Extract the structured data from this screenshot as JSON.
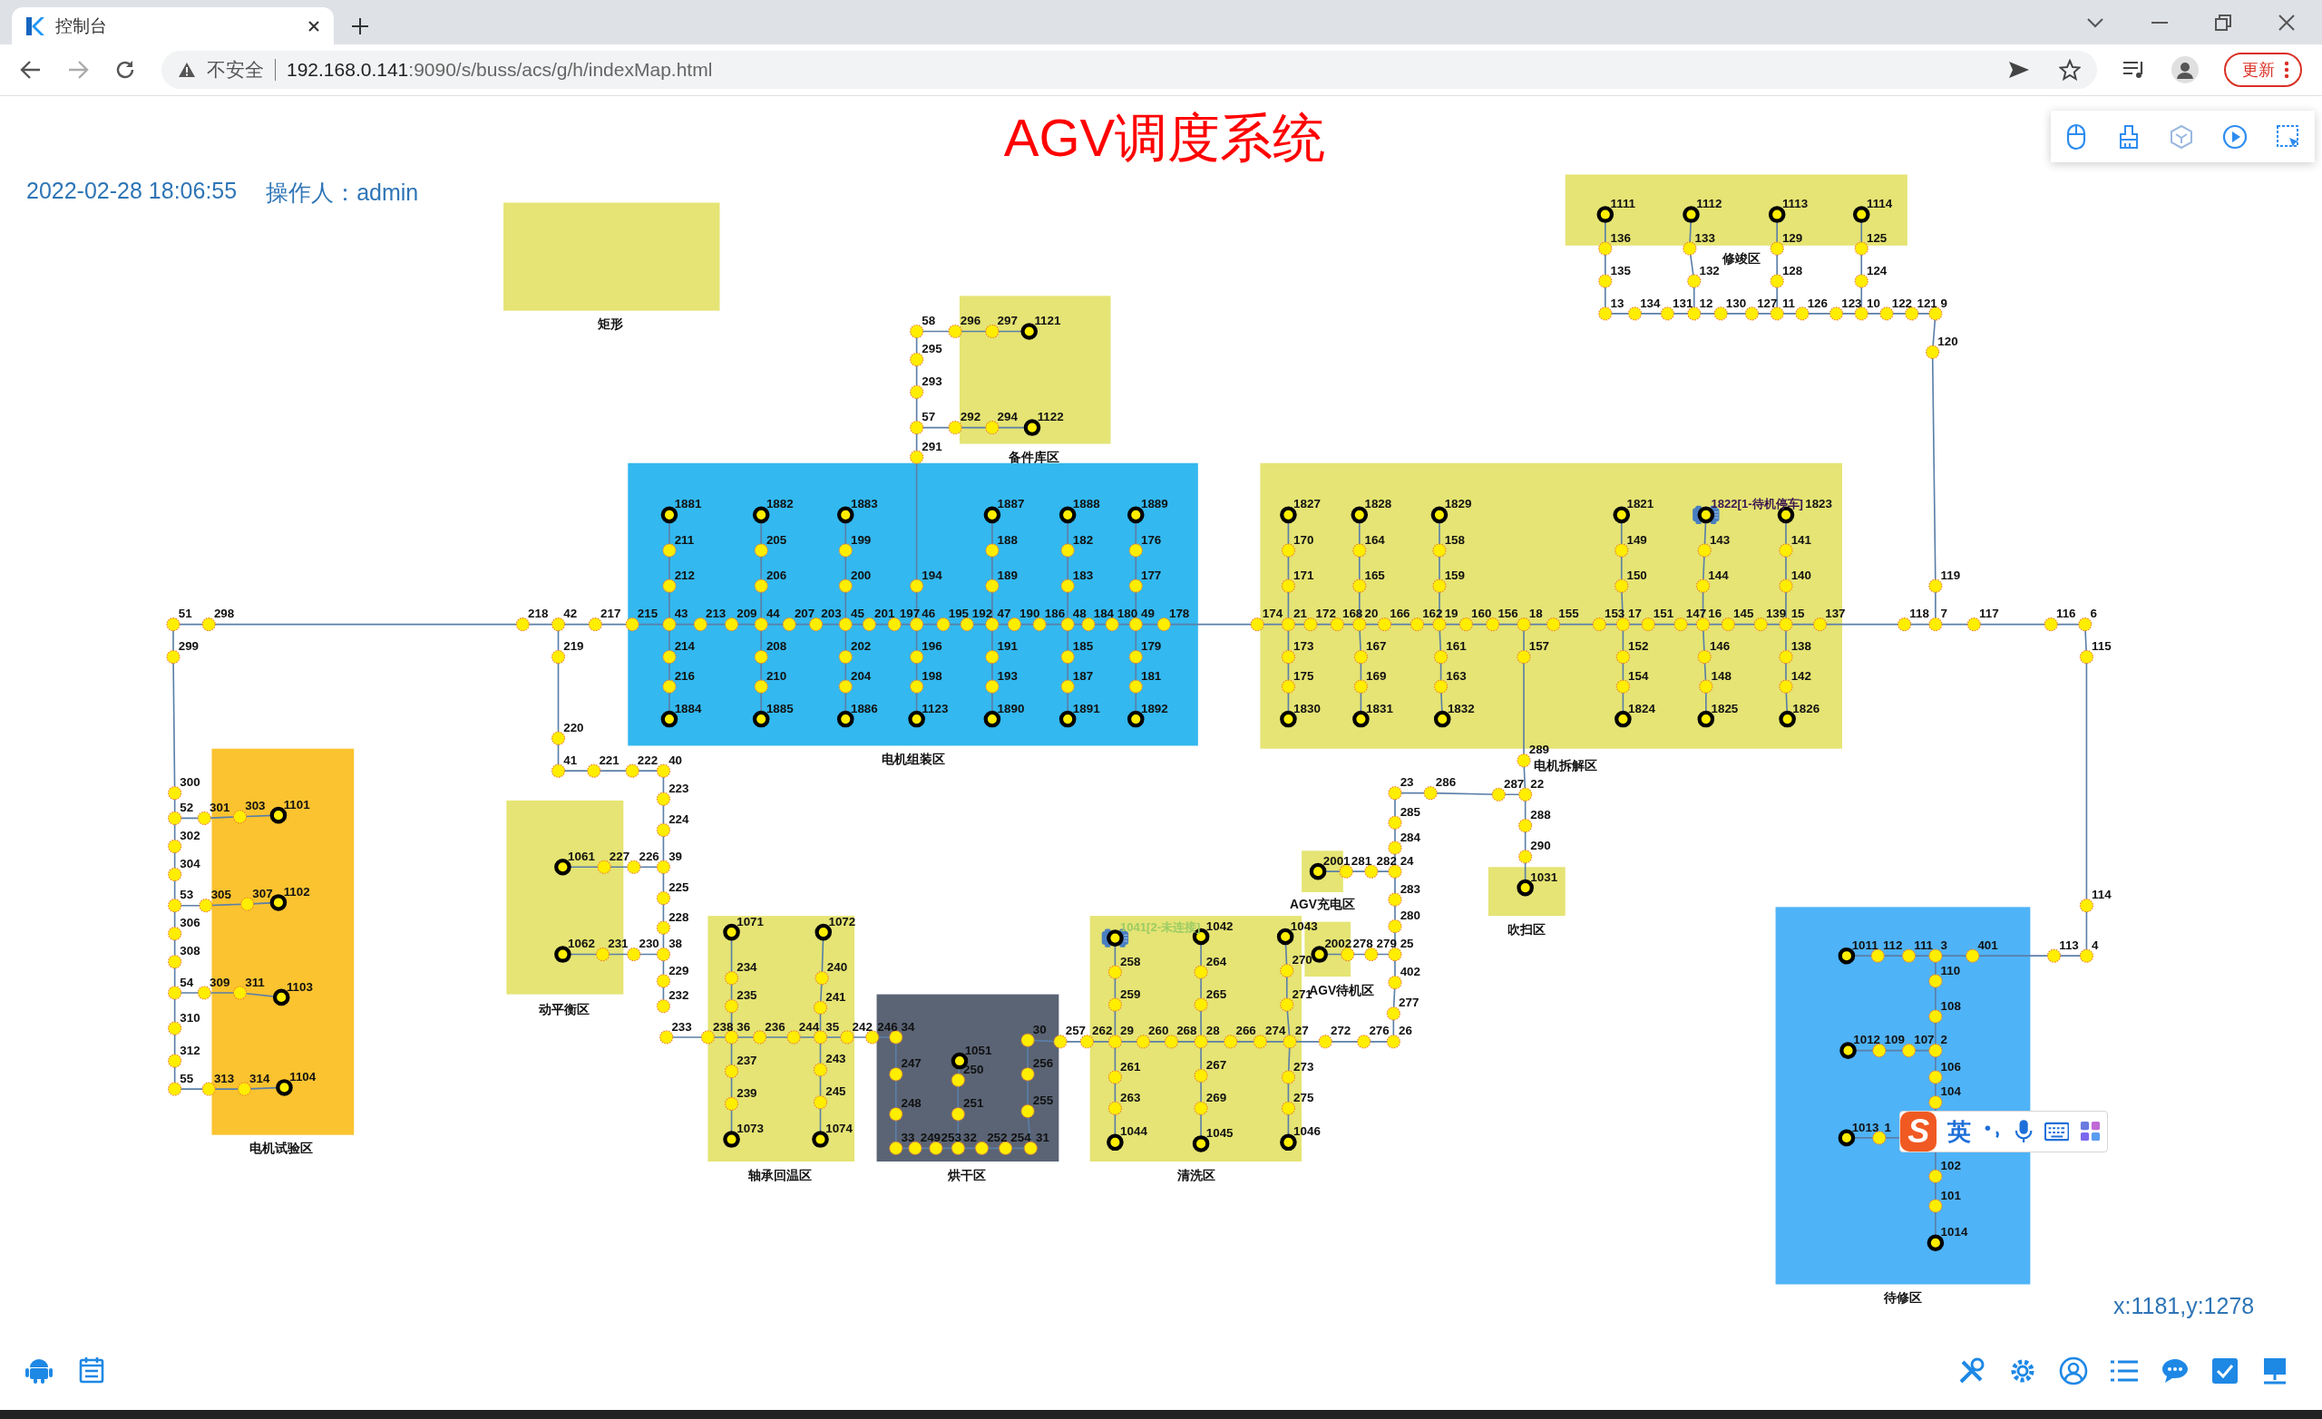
{
  "browser": {
    "tab": {
      "title": "控制台",
      "selected": true
    },
    "security": "不安全",
    "url_host": "192.168.0.141",
    "url_path": ":9090/s/buss/acs/g/h/indexMap.html",
    "update_button": "更新"
  },
  "header": {
    "title": "AGV调度系统",
    "datetime": "2022-02-28 18:06:55",
    "operator": "操作人：admin"
  },
  "zones": [
    {
      "label": "矩形",
      "color": "#e5e474"
    },
    {
      "label": "修竣区",
      "color": "#e5e474"
    },
    {
      "label": "备件库区",
      "color": "#e5e474"
    },
    {
      "label": "电机组装区",
      "color": "#33b8ef"
    },
    {
      "label": "电机拆解区",
      "color": "#e5e474"
    },
    {
      "label": "电机试验区",
      "color": "#fbc330"
    },
    {
      "label": "动平衡区",
      "color": "#e5e474"
    },
    {
      "label": "轴承回温区",
      "color": "#e5e474"
    },
    {
      "label": "烘干区",
      "color": "#5a6475"
    },
    {
      "label": "清洗区",
      "color": "#e5e474"
    },
    {
      "label": "AGV充电区",
      "color": "#e5e474"
    },
    {
      "label": "AGV待机区",
      "color": "#e5e474"
    },
    {
      "label": "吹扫区",
      "color": "#e5e474"
    },
    {
      "label": "待修区",
      "color": "#4fb3f7"
    }
  ],
  "nodes": [
    {
      "label": "1111",
      "kind": "station"
    },
    {
      "label": "1112",
      "kind": "station"
    },
    {
      "label": "1113",
      "kind": "station"
    },
    {
      "label": "1114",
      "kind": "station"
    },
    {
      "label": "136",
      "kind": "point"
    },
    {
      "label": "133",
      "kind": "point"
    },
    {
      "label": "129",
      "kind": "point"
    },
    {
      "label": "125",
      "kind": "point"
    },
    {
      "label": "135",
      "kind": "point"
    },
    {
      "label": "132",
      "kind": "point"
    },
    {
      "label": "128",
      "kind": "point"
    },
    {
      "label": "124",
      "kind": "point"
    },
    {
      "label": "13",
      "kind": "point"
    },
    {
      "label": "134",
      "kind": "point"
    },
    {
      "label": "131",
      "kind": "point"
    },
    {
      "label": "12",
      "kind": "point"
    },
    {
      "label": "130",
      "kind": "point"
    },
    {
      "label": "127",
      "kind": "point"
    },
    {
      "label": "11",
      "kind": "point"
    },
    {
      "label": "126",
      "kind": "point"
    },
    {
      "label": "123",
      "kind": "point"
    },
    {
      "label": "10",
      "kind": "point"
    },
    {
      "label": "122",
      "kind": "point"
    },
    {
      "label": "121",
      "kind": "point"
    },
    {
      "label": "9",
      "kind": "point"
    },
    {
      "label": "58",
      "kind": "point"
    },
    {
      "label": "296",
      "kind": "point"
    },
    {
      "label": "297",
      "kind": "point"
    },
    {
      "label": "1121",
      "kind": "station"
    },
    {
      "label": "295",
      "kind": "point"
    },
    {
      "label": "120",
      "kind": "point"
    },
    {
      "label": "293",
      "kind": "point"
    },
    {
      "label": "57",
      "kind": "point"
    },
    {
      "label": "292",
      "kind": "point"
    },
    {
      "label": "294",
      "kind": "point"
    },
    {
      "label": "1122",
      "kind": "station"
    },
    {
      "label": "291",
      "kind": "point"
    },
    {
      "label": "1881",
      "kind": "station"
    },
    {
      "label": "1882",
      "kind": "station"
    },
    {
      "label": "1883",
      "kind": "station"
    },
    {
      "label": "1887",
      "kind": "station"
    },
    {
      "label": "1888",
      "kind": "station"
    },
    {
      "label": "1889",
      "kind": "station"
    },
    {
      "label": "1827",
      "kind": "station"
    },
    {
      "label": "1828",
      "kind": "station"
    },
    {
      "label": "1829",
      "kind": "station"
    },
    {
      "label": "1821",
      "kind": "station"
    },
    {
      "label": "1822[1-待机停车]",
      "kind": "station",
      "vehicle": true,
      "connected": true
    },
    {
      "label": "1823",
      "kind": "station"
    },
    {
      "label": "211",
      "kind": "point"
    },
    {
      "label": "205",
      "kind": "point"
    },
    {
      "label": "199",
      "kind": "point"
    },
    {
      "label": "188",
      "kind": "point"
    },
    {
      "label": "182",
      "kind": "point"
    },
    {
      "label": "176",
      "kind": "point"
    },
    {
      "label": "170",
      "kind": "point"
    },
    {
      "label": "164",
      "kind": "point"
    },
    {
      "label": "158",
      "kind": "point"
    },
    {
      "label": "149",
      "kind": "point"
    },
    {
      "label": "143",
      "kind": "point"
    },
    {
      "label": "141",
      "kind": "point"
    },
    {
      "label": "212",
      "kind": "point"
    },
    {
      "label": "206",
      "kind": "point"
    },
    {
      "label": "200",
      "kind": "point"
    },
    {
      "label": "194",
      "kind": "point"
    },
    {
      "label": "189",
      "kind": "point"
    },
    {
      "label": "183",
      "kind": "point"
    },
    {
      "label": "177",
      "kind": "point"
    },
    {
      "label": "171",
      "kind": "point"
    },
    {
      "label": "165",
      "kind": "point"
    },
    {
      "label": "159",
      "kind": "point"
    },
    {
      "label": "150",
      "kind": "point"
    },
    {
      "label": "144",
      "kind": "point"
    },
    {
      "label": "140",
      "kind": "point"
    },
    {
      "label": "119",
      "kind": "point"
    },
    {
      "label": "51",
      "kind": "point"
    },
    {
      "label": "298",
      "kind": "point"
    },
    {
      "label": "218",
      "kind": "point"
    },
    {
      "label": "42",
      "kind": "point"
    },
    {
      "label": "217",
      "kind": "point"
    },
    {
      "label": "215",
      "kind": "point"
    },
    {
      "label": "43",
      "kind": "point"
    },
    {
      "label": "213",
      "kind": "point"
    },
    {
      "label": "209",
      "kind": "point"
    },
    {
      "label": "44",
      "kind": "point"
    },
    {
      "label": "207",
      "kind": "point"
    },
    {
      "label": "203",
      "kind": "point"
    },
    {
      "label": "45",
      "kind": "point"
    },
    {
      "label": "201",
      "kind": "point"
    },
    {
      "label": "197",
      "kind": "point"
    },
    {
      "label": "46",
      "kind": "point"
    },
    {
      "label": "195",
      "kind": "point"
    },
    {
      "label": "192",
      "kind": "point"
    },
    {
      "label": "47",
      "kind": "point"
    },
    {
      "label": "190",
      "kind": "point"
    },
    {
      "label": "186",
      "kind": "point"
    },
    {
      "label": "48",
      "kind": "point"
    },
    {
      "label": "184",
      "kind": "point"
    },
    {
      "label": "180",
      "kind": "point"
    },
    {
      "label": "49",
      "kind": "point"
    },
    {
      "label": "178",
      "kind": "point"
    },
    {
      "label": "174",
      "kind": "point"
    },
    {
      "label": "21",
      "kind": "point"
    },
    {
      "label": "172",
      "kind": "point"
    },
    {
      "label": "168",
      "kind": "point"
    },
    {
      "label": "20",
      "kind": "point"
    },
    {
      "label": "166",
      "kind": "point"
    },
    {
      "label": "162",
      "kind": "point"
    },
    {
      "label": "19",
      "kind": "point"
    },
    {
      "label": "160",
      "kind": "point"
    },
    {
      "label": "156",
      "kind": "point"
    },
    {
      "label": "18",
      "kind": "point"
    },
    {
      "label": "155",
      "kind": "point"
    },
    {
      "label": "153",
      "kind": "point"
    },
    {
      "label": "17",
      "kind": "point"
    },
    {
      "label": "151",
      "kind": "point"
    },
    {
      "label": "147",
      "kind": "point"
    },
    {
      "label": "16",
      "kind": "point"
    },
    {
      "label": "145",
      "kind": "point"
    },
    {
      "label": "139",
      "kind": "point"
    },
    {
      "label": "15",
      "kind": "point"
    },
    {
      "label": "137",
      "kind": "point"
    },
    {
      "label": "118",
      "kind": "point"
    },
    {
      "label": "7",
      "kind": "point"
    },
    {
      "label": "117",
      "kind": "point"
    },
    {
      "label": "116",
      "kind": "point"
    },
    {
      "label": "6",
      "kind": "point"
    },
    {
      "label": "299",
      "kind": "point"
    },
    {
      "label": "219",
      "kind": "point"
    },
    {
      "label": "214",
      "kind": "point"
    },
    {
      "label": "208",
      "kind": "point"
    },
    {
      "label": "202",
      "kind": "point"
    },
    {
      "label": "196",
      "kind": "point"
    },
    {
      "label": "191",
      "kind": "point"
    },
    {
      "label": "185",
      "kind": "point"
    },
    {
      "label": "179",
      "kind": "point"
    },
    {
      "label": "173",
      "kind": "point"
    },
    {
      "label": "167",
      "kind": "point"
    },
    {
      "label": "161",
      "kind": "point"
    },
    {
      "label": "157",
      "kind": "point"
    },
    {
      "label": "152",
      "kind": "point"
    },
    {
      "label": "146",
      "kind": "point"
    },
    {
      "label": "138",
      "kind": "point"
    },
    {
      "label": "115",
      "kind": "point"
    },
    {
      "label": "216",
      "kind": "point"
    },
    {
      "label": "210",
      "kind": "point"
    },
    {
      "label": "204",
      "kind": "point"
    },
    {
      "label": "198",
      "kind": "point"
    },
    {
      "label": "193",
      "kind": "point"
    },
    {
      "label": "187",
      "kind": "point"
    },
    {
      "label": "181",
      "kind": "point"
    },
    {
      "label": "175",
      "kind": "point"
    },
    {
      "label": "169",
      "kind": "point"
    },
    {
      "label": "163",
      "kind": "point"
    },
    {
      "label": "154",
      "kind": "point"
    },
    {
      "label": "148",
      "kind": "point"
    },
    {
      "label": "142",
      "kind": "point"
    },
    {
      "label": "1884",
      "kind": "station"
    },
    {
      "label": "1885",
      "kind": "station"
    },
    {
      "label": "1886",
      "kind": "station"
    },
    {
      "label": "1123",
      "kind": "station"
    },
    {
      "label": "1890",
      "kind": "station"
    },
    {
      "label": "1891",
      "kind": "station"
    },
    {
      "label": "1892",
      "kind": "station"
    },
    {
      "label": "1830",
      "kind": "station"
    },
    {
      "label": "1831",
      "kind": "station"
    },
    {
      "label": "1832",
      "kind": "station"
    },
    {
      "label": "1824",
      "kind": "station"
    },
    {
      "label": "1825",
      "kind": "station"
    },
    {
      "label": "1826",
      "kind": "station"
    },
    {
      "label": "220",
      "kind": "point"
    },
    {
      "label": "41",
      "kind": "point"
    },
    {
      "label": "221",
      "kind": "point"
    },
    {
      "label": "222",
      "kind": "point"
    },
    {
      "label": "40",
      "kind": "point"
    },
    {
      "label": "289",
      "kind": "point"
    },
    {
      "label": "300",
      "kind": "point"
    },
    {
      "label": "223",
      "kind": "point"
    },
    {
      "label": "23",
      "kind": "point"
    },
    {
      "label": "286",
      "kind": "point"
    },
    {
      "label": "287",
      "kind": "point"
    },
    {
      "label": "22",
      "kind": "point"
    },
    {
      "label": "52",
      "kind": "point"
    },
    {
      "label": "301",
      "kind": "point"
    },
    {
      "label": "303",
      "kind": "point"
    },
    {
      "label": "1101",
      "kind": "station"
    },
    {
      "label": "224",
      "kind": "point"
    },
    {
      "label": "285",
      "kind": "point"
    },
    {
      "label": "288",
      "kind": "point"
    },
    {
      "label": "302",
      "kind": "point"
    },
    {
      "label": "284",
      "kind": "point"
    },
    {
      "label": "290",
      "kind": "point"
    },
    {
      "label": "304",
      "kind": "point"
    },
    {
      "label": "1061",
      "kind": "station"
    },
    {
      "label": "227",
      "kind": "point"
    },
    {
      "label": "226",
      "kind": "point"
    },
    {
      "label": "39",
      "kind": "point"
    },
    {
      "label": "2001",
      "kind": "station"
    },
    {
      "label": "281",
      "kind": "point"
    },
    {
      "label": "282",
      "kind": "point"
    },
    {
      "label": "24",
      "kind": "point"
    },
    {
      "label": "1031",
      "kind": "station"
    },
    {
      "label": "53",
      "kind": "point"
    },
    {
      "label": "305",
      "kind": "point"
    },
    {
      "label": "307",
      "kind": "point"
    },
    {
      "label": "1102",
      "kind": "station"
    },
    {
      "label": "225",
      "kind": "point"
    },
    {
      "label": "283",
      "kind": "point"
    },
    {
      "label": "114",
      "kind": "point"
    },
    {
      "label": "306",
      "kind": "point"
    },
    {
      "label": "228",
      "kind": "point"
    },
    {
      "label": "1071",
      "kind": "station"
    },
    {
      "label": "1072",
      "kind": "station"
    },
    {
      "label": "1041[2-未连接]",
      "kind": "station",
      "vehicle": true,
      "connected": false
    },
    {
      "label": "1042",
      "kind": "station"
    },
    {
      "label": "1043",
      "kind": "station"
    },
    {
      "label": "280",
      "kind": "point"
    },
    {
      "label": "308",
      "kind": "point"
    },
    {
      "label": "1062",
      "kind": "station"
    },
    {
      "label": "231",
      "kind": "point"
    },
    {
      "label": "230",
      "kind": "point"
    },
    {
      "label": "38",
      "kind": "point"
    },
    {
      "label": "2002",
      "kind": "station"
    },
    {
      "label": "278",
      "kind": "point"
    },
    {
      "label": "279",
      "kind": "point"
    },
    {
      "label": "25",
      "kind": "point"
    },
    {
      "label": "1011",
      "kind": "station"
    },
    {
      "label": "112",
      "kind": "point"
    },
    {
      "label": "111",
      "kind": "point"
    },
    {
      "label": "3",
      "kind": "point"
    },
    {
      "label": "401",
      "kind": "point"
    },
    {
      "label": "113",
      "kind": "point"
    },
    {
      "label": "4",
      "kind": "point"
    },
    {
      "label": "229",
      "kind": "point"
    },
    {
      "label": "234",
      "kind": "point"
    },
    {
      "label": "240",
      "kind": "point"
    },
    {
      "label": "258",
      "kind": "point"
    },
    {
      "label": "264",
      "kind": "point"
    },
    {
      "label": "270",
      "kind": "point"
    },
    {
      "label": "402",
      "kind": "point"
    },
    {
      "label": "110",
      "kind": "point"
    },
    {
      "label": "54",
      "kind": "point"
    },
    {
      "label": "309",
      "kind": "point"
    },
    {
      "label": "311",
      "kind": "point"
    },
    {
      "label": "1103",
      "kind": "station"
    },
    {
      "label": "232",
      "kind": "point"
    },
    {
      "label": "235",
      "kind": "point"
    },
    {
      "label": "241",
      "kind": "point"
    },
    {
      "label": "259",
      "kind": "point"
    },
    {
      "label": "265",
      "kind": "point"
    },
    {
      "label": "271",
      "kind": "point"
    },
    {
      "label": "277",
      "kind": "point"
    },
    {
      "label": "108",
      "kind": "point"
    },
    {
      "label": "310",
      "kind": "point"
    },
    {
      "label": "233",
      "kind": "point"
    },
    {
      "label": "238",
      "kind": "point"
    },
    {
      "label": "36",
      "kind": "point"
    },
    {
      "label": "236",
      "kind": "point"
    },
    {
      "label": "244",
      "kind": "point"
    },
    {
      "label": "35",
      "kind": "point"
    },
    {
      "label": "242",
      "kind": "point"
    },
    {
      "label": "246",
      "kind": "point"
    },
    {
      "label": "34",
      "kind": "point"
    },
    {
      "label": "30",
      "kind": "point"
    },
    {
      "label": "257",
      "kind": "point"
    },
    {
      "label": "262",
      "kind": "point"
    },
    {
      "label": "29",
      "kind": "point"
    },
    {
      "label": "260",
      "kind": "point"
    },
    {
      "label": "268",
      "kind": "point"
    },
    {
      "label": "28",
      "kind": "point"
    },
    {
      "label": "266",
      "kind": "point"
    },
    {
      "label": "274",
      "kind": "point"
    },
    {
      "label": "27",
      "kind": "point"
    },
    {
      "label": "272",
      "kind": "point"
    },
    {
      "label": "276",
      "kind": "point"
    },
    {
      "label": "26",
      "kind": "point"
    },
    {
      "label": "1012",
      "kind": "station"
    },
    {
      "label": "109",
      "kind": "point"
    },
    {
      "label": "107",
      "kind": "point"
    },
    {
      "label": "2",
      "kind": "point"
    },
    {
      "label": "312",
      "kind": "point"
    },
    {
      "label": "237",
      "kind": "point"
    },
    {
      "label": "243",
      "kind": "point"
    },
    {
      "label": "247",
      "kind": "point"
    },
    {
      "label": "1051",
      "kind": "station"
    },
    {
      "label": "250",
      "kind": "point"
    },
    {
      "label": "256",
      "kind": "point"
    },
    {
      "label": "261",
      "kind": "point"
    },
    {
      "label": "267",
      "kind": "point"
    },
    {
      "label": "273",
      "kind": "point"
    },
    {
      "label": "106",
      "kind": "point"
    },
    {
      "label": "55",
      "kind": "point"
    },
    {
      "label": "313",
      "kind": "point"
    },
    {
      "label": "314",
      "kind": "point"
    },
    {
      "label": "1104",
      "kind": "station"
    },
    {
      "label": "239",
      "kind": "point"
    },
    {
      "label": "245",
      "kind": "point"
    },
    {
      "label": "248",
      "kind": "point"
    },
    {
      "label": "251",
      "kind": "point"
    },
    {
      "label": "255",
      "kind": "point"
    },
    {
      "label": "263",
      "kind": "point"
    },
    {
      "label": "269",
      "kind": "point"
    },
    {
      "label": "275",
      "kind": "point"
    },
    {
      "label": "104",
      "kind": "point"
    },
    {
      "label": "1073",
      "kind": "station"
    },
    {
      "label": "1074",
      "kind": "station"
    },
    {
      "label": "33",
      "kind": "point"
    },
    {
      "label": "249",
      "kind": "point"
    },
    {
      "label": "253",
      "kind": "point"
    },
    {
      "label": "32",
      "kind": "point"
    },
    {
      "label": "252",
      "kind": "point"
    },
    {
      "label": "254",
      "kind": "point"
    },
    {
      "label": "31",
      "kind": "point"
    },
    {
      "label": "1044",
      "kind": "station"
    },
    {
      "label": "1045",
      "kind": "station"
    },
    {
      "label": "1046",
      "kind": "station"
    },
    {
      "label": "1013",
      "kind": "station"
    },
    {
      "label": "1",
      "kind": "point"
    },
    {
      "label": "102",
      "kind": "point"
    },
    {
      "label": "101",
      "kind": "point"
    },
    {
      "label": "1014",
      "kind": "station"
    }
  ],
  "cursor_position": "x:1181,y:1278",
  "ime": {
    "logo": "S",
    "mode": "英"
  }
}
